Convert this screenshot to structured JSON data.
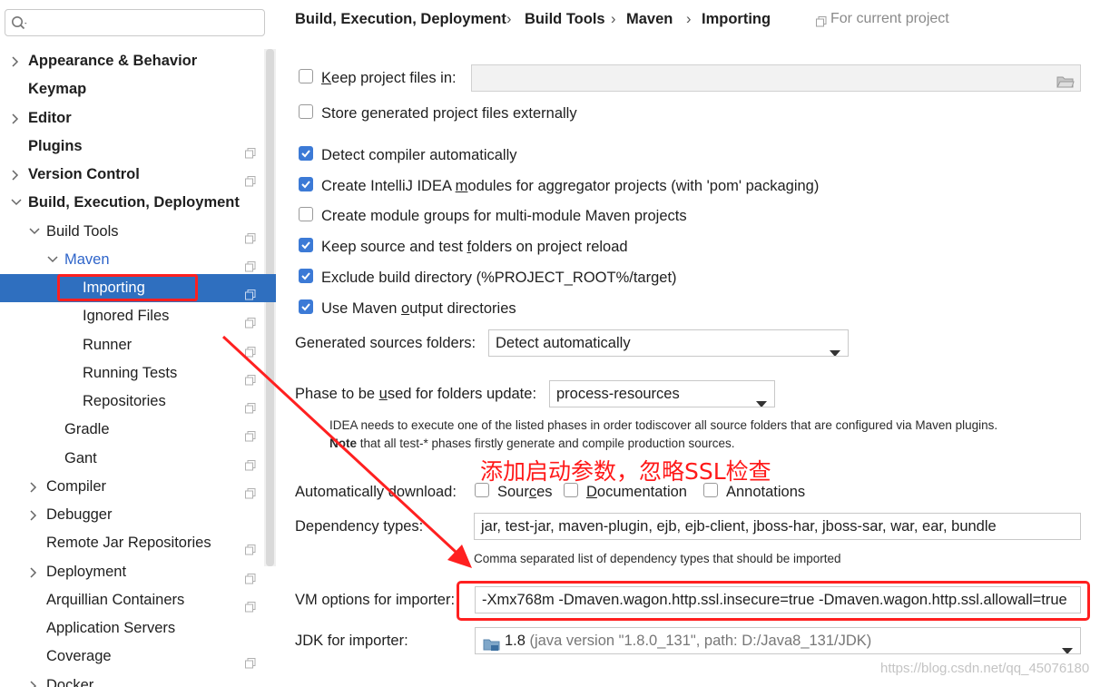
{
  "search": {
    "placeholder": "",
    "value": ""
  },
  "sidebar": {
    "items": [
      {
        "label": "Appearance & Behavior"
      },
      {
        "label": "Keymap"
      },
      {
        "label": "Editor"
      },
      {
        "label": "Plugins"
      },
      {
        "label": "Version Control"
      },
      {
        "label": "Build, Execution, Deployment"
      },
      {
        "label": "Build Tools"
      },
      {
        "label": "Maven"
      },
      {
        "label": "Importing"
      },
      {
        "label": "Ignored Files"
      },
      {
        "label": "Runner"
      },
      {
        "label": "Running Tests"
      },
      {
        "label": "Repositories"
      },
      {
        "label": "Gradle"
      },
      {
        "label": "Gant"
      },
      {
        "label": "Compiler"
      },
      {
        "label": "Debugger"
      },
      {
        "label": "Remote Jar Repositories"
      },
      {
        "label": "Deployment"
      },
      {
        "label": "Arquillian Containers"
      },
      {
        "label": "Application Servers"
      },
      {
        "label": "Coverage"
      },
      {
        "label": "Docker"
      }
    ]
  },
  "breadcrumb": {
    "items": [
      "Build, Execution, Deployment",
      "Build Tools",
      "Maven",
      "Importing"
    ],
    "separator": "›",
    "scope_note": "For current project"
  },
  "settings": {
    "keep_project_files": {
      "pre": "",
      "u": "K",
      "post": "eep project files in:",
      "checked": false,
      "path_value": ""
    },
    "store_generated": {
      "label": "Store generated project files externally",
      "checked": false
    },
    "detect_compiler": {
      "label": "Detect compiler automatically",
      "checked": true
    },
    "create_modules": {
      "pre": "Create IntelliJ IDEA ",
      "u": "m",
      "post": "odules for aggregator projects (with 'pom' packaging)",
      "checked": true
    },
    "create_groups": {
      "pre": "Create module ",
      "u": "g",
      "post": "roups for multi-module Maven projects",
      "checked": false
    },
    "keep_source": {
      "pre": "Keep source and test ",
      "u": "f",
      "post": "olders on project reload",
      "checked": true
    },
    "exclude_build": {
      "label": "Exclude build directory (%PROJECT_ROOT%/target)",
      "checked": true
    },
    "use_output": {
      "pre": "Use Maven ",
      "u": "o",
      "post": "utput directories",
      "checked": true
    },
    "generated_sources": {
      "label": "Generated sources folders:",
      "value": "Detect automatically"
    },
    "phase": {
      "pre": "Phase to be ",
      "u": "u",
      "post": "sed for folders update:",
      "value": "process-resources"
    },
    "phase_hint_1": "IDEA needs to execute one of the listed phases in order todiscover all source folders that are configured via Maven plugins.",
    "phase_hint_2_bold": "Note",
    "phase_hint_2": " that all test-* phases firstly generate and compile production sources.",
    "auto_download": {
      "label": "Automatically download:",
      "sources": {
        "pre": "Sour",
        "u": "c",
        "post": "es",
        "checked": false
      },
      "documentation": {
        "pre": "",
        "u": "D",
        "post": "ocumentation",
        "checked": false
      },
      "annotations": {
        "label": "Annotations",
        "checked": false
      }
    },
    "dependency_types": {
      "label": "Dependency types:",
      "value": "jar, test-jar, maven-plugin, ejb, ejb-client, jboss-har, jboss-sar, war, ear, bundle",
      "hint": "Comma separated list of dependency types that should be imported"
    },
    "vm_options": {
      "label": "VM options for importer:",
      "value": "-Xmx768m -Dmaven.wagon.http.ssl.insecure=true -Dmaven.wagon.http.ssl.allowall=true"
    },
    "jdk": {
      "label": "JDK for importer:",
      "version": "1.8",
      "detail": " (java version \"1.8.0_131\", path: D:/Java8_131/JDK)"
    }
  },
  "annotation": {
    "text": "添加启动参数，忽略SSL检查",
    "color": "#ff1a1a"
  },
  "watermark": "https://blog.csdn.net/qq_45076180",
  "colors": {
    "selection": "#2f6fbf",
    "checkbox": "#3c7ad6",
    "link_blue": "#2f65ca",
    "annotation_red": "#ff2020"
  }
}
